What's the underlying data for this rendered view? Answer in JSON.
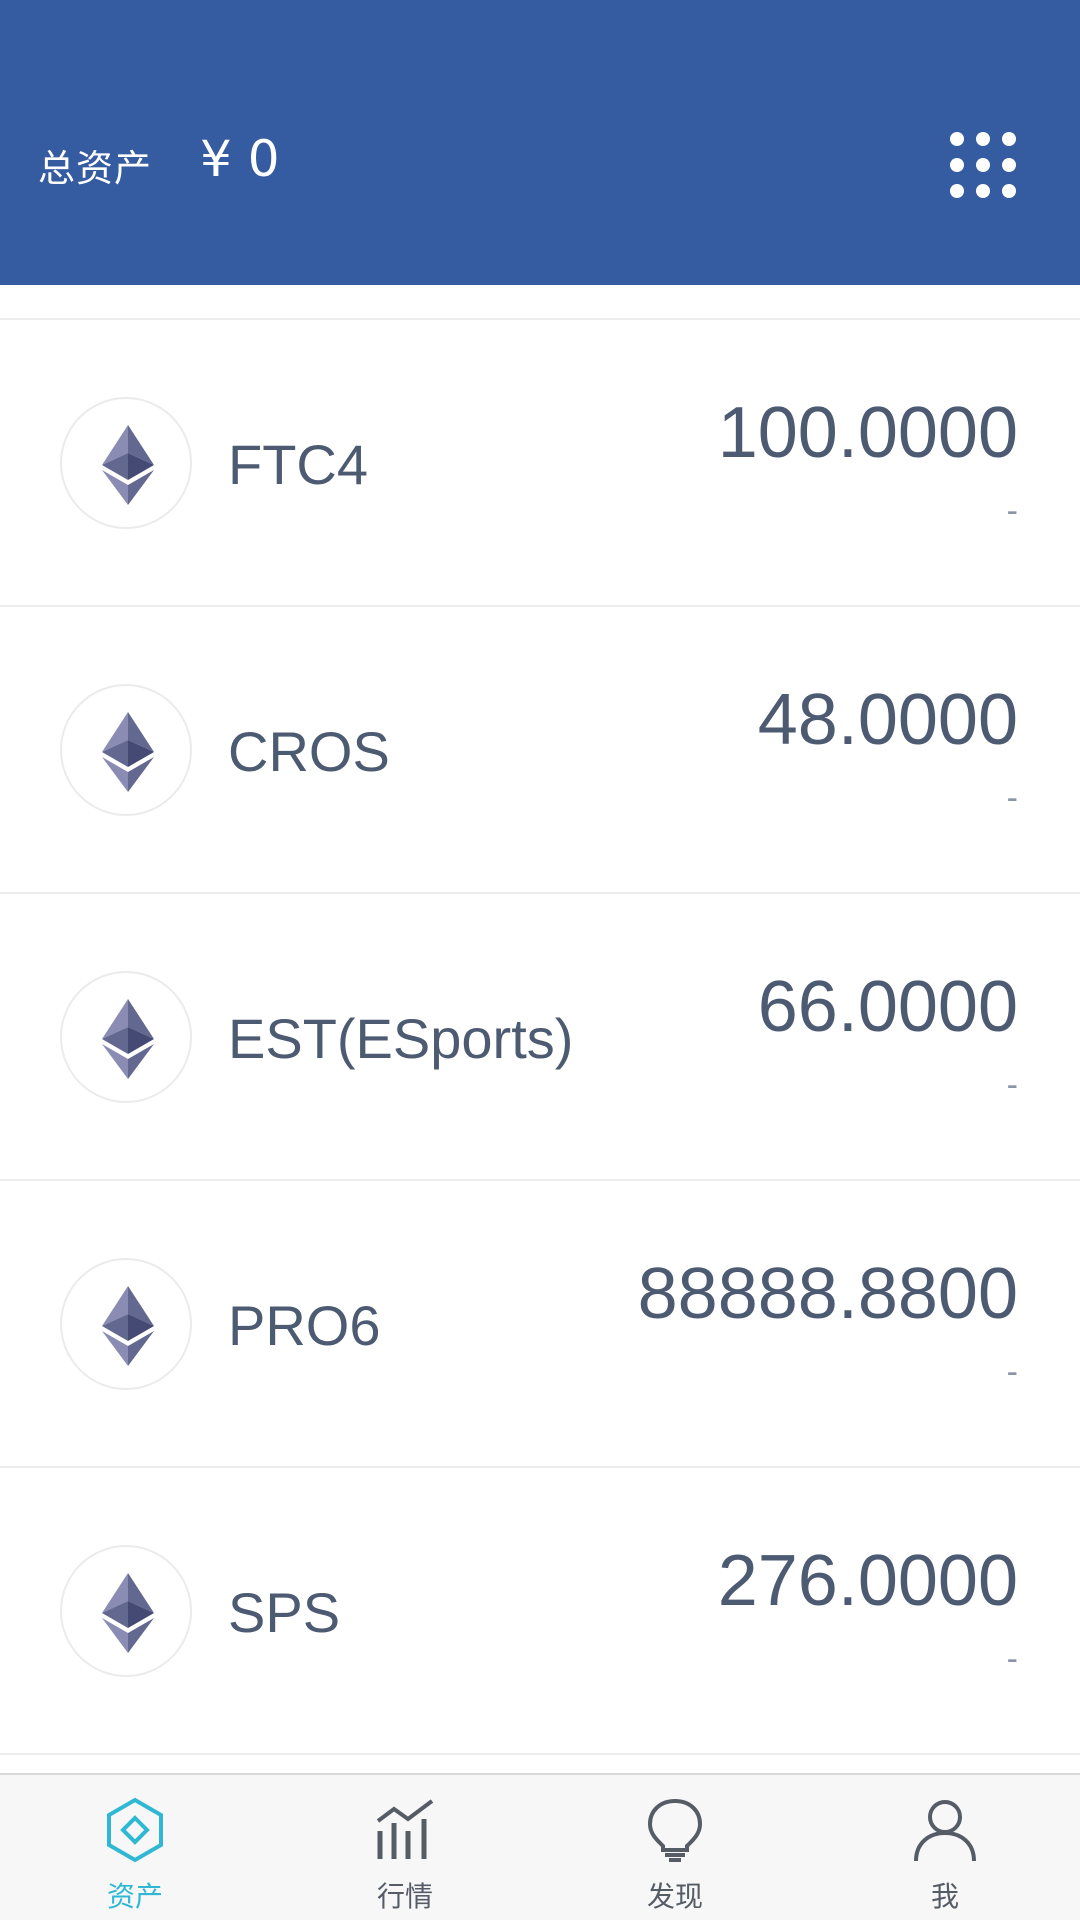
{
  "header": {
    "label": "总资产",
    "value": "¥ 0",
    "menu_icon": "grid-dots-icon"
  },
  "assets": [
    {
      "name": "FTC4",
      "amount": "100.0000",
      "sub": "-",
      "icon": "ethereum-icon"
    },
    {
      "name": "CROS",
      "amount": "48.0000",
      "sub": "-",
      "icon": "ethereum-icon"
    },
    {
      "name": "EST(ESports)",
      "amount": "66.0000",
      "sub": "-",
      "icon": "ethereum-icon"
    },
    {
      "name": "PRO6",
      "amount": "88888.8800",
      "sub": "-",
      "icon": "ethereum-icon"
    },
    {
      "name": "SPS",
      "amount": "276.0000",
      "sub": "-",
      "icon": "ethereum-icon"
    }
  ],
  "tabbar": {
    "tabs": [
      {
        "label": "资产",
        "icon": "asset-diamond-icon",
        "active": true
      },
      {
        "label": "行情",
        "icon": "chart-bars-icon",
        "active": false
      },
      {
        "label": "发现",
        "icon": "lightbulb-icon",
        "active": false
      },
      {
        "label": "我",
        "icon": "user-icon",
        "active": false
      }
    ]
  },
  "colors": {
    "header_bg": "#355ba0",
    "accent": "#2fb8d3",
    "text": "#4d5b72"
  }
}
